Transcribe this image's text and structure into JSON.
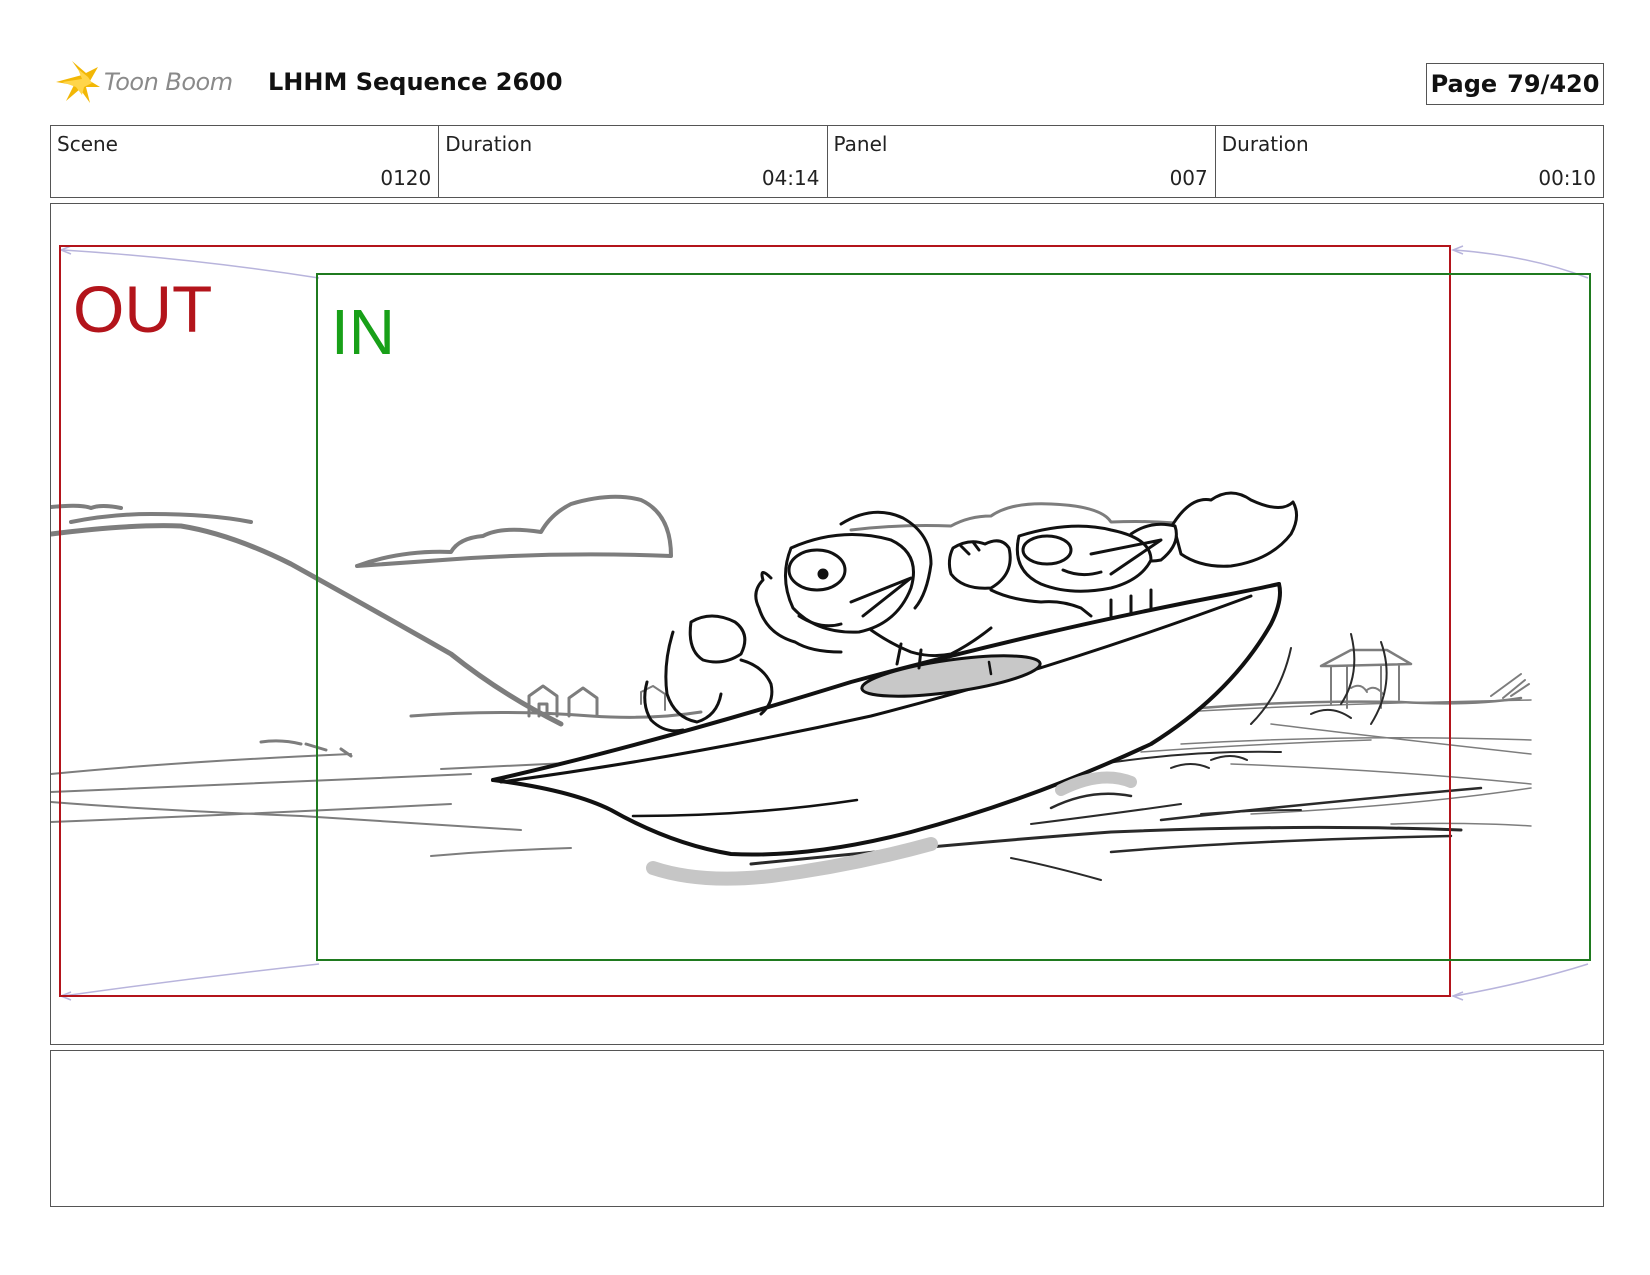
{
  "header": {
    "logo_text": "Toon Boom",
    "sequence_title": "LHHM Sequence 2600",
    "page_label": "Page",
    "page_number": "79/420"
  },
  "info": {
    "scene_label": "Scene",
    "scene_value": "0120",
    "scene_duration_label": "Duration",
    "scene_duration_value": "04:14",
    "panel_label": "Panel",
    "panel_value": "007",
    "panel_duration_label": "Duration",
    "panel_duration_value": "00:10"
  },
  "panel": {
    "out_label": "OUT",
    "in_label": "IN",
    "colors": {
      "out_frame": "#b3141b",
      "in_frame": "#1f7a1f",
      "in_text": "#18a018",
      "camera_path": "#b8b4dc"
    }
  },
  "colors": {
    "logo_star": "#f2b705",
    "logo_text": "#8a8a8a",
    "border": "#555555"
  }
}
